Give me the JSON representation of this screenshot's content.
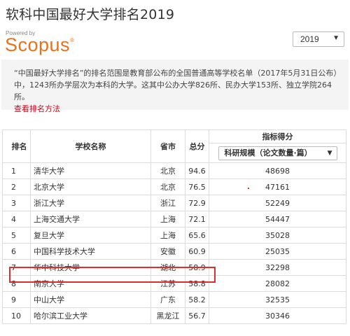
{
  "page": {
    "title": "软科中国最好大学排名2019",
    "powered_by": "Powered by",
    "brand": "Scopus",
    "brand_mark": "®"
  },
  "year_select": {
    "value": "2019",
    "arrow": "▼"
  },
  "description": {
    "text": "“中国最好大学排名”的排名范围是教育部公布的全国普通高等学校名单（2017年5月31日公布）中，1243所办学层次为本科的大学。这其中公办大学826所、民办大学153所、独立学院264所。",
    "method_link": "查看排名方法"
  },
  "table": {
    "headers": {
      "indicator_group": "指标得分",
      "rank": "排名",
      "name": "学校名称",
      "province": "省市",
      "score": "总分",
      "indicator_select": "科研规模（论文数量·篇）",
      "indicator_arrow": "▼"
    },
    "rows": [
      {
        "rank": "1",
        "name": "清华大学",
        "province": "北京",
        "score": "94.6",
        "indicator": "48698"
      },
      {
        "rank": "2",
        "name": "北京大学",
        "province": "北京",
        "score": "76.5",
        "indicator": "47161"
      },
      {
        "rank": "3",
        "name": "浙江大学",
        "province": "浙江",
        "score": "72.9",
        "indicator": "52249"
      },
      {
        "rank": "4",
        "name": "上海交通大学",
        "province": "上海",
        "score": "72.1",
        "indicator": "54447"
      },
      {
        "rank": "5",
        "name": "复旦大学",
        "province": "上海",
        "score": "65.6",
        "indicator": "35028"
      },
      {
        "rank": "6",
        "name": "中国科学技术大学",
        "province": "安徽",
        "score": "60.9",
        "indicator": "25035"
      },
      {
        "rank": "7",
        "name": "华中科技大学",
        "province": "湖北",
        "score": "58.9",
        "indicator": "32298"
      },
      {
        "rank": "8",
        "name": "南京大学",
        "province": "江苏",
        "score": "58.8",
        "indicator": "28082"
      },
      {
        "rank": "9",
        "name": "中山大学",
        "province": "广东",
        "score": "58.2",
        "indicator": "32535"
      },
      {
        "rank": "10",
        "name": "哈尔滨工业大学",
        "province": "黑龙江",
        "score": "56.7",
        "indicator": "30346"
      }
    ]
  },
  "colors": {
    "brand": "#e9711c",
    "highlight": "#e22b2b",
    "link": "#d0021b"
  }
}
